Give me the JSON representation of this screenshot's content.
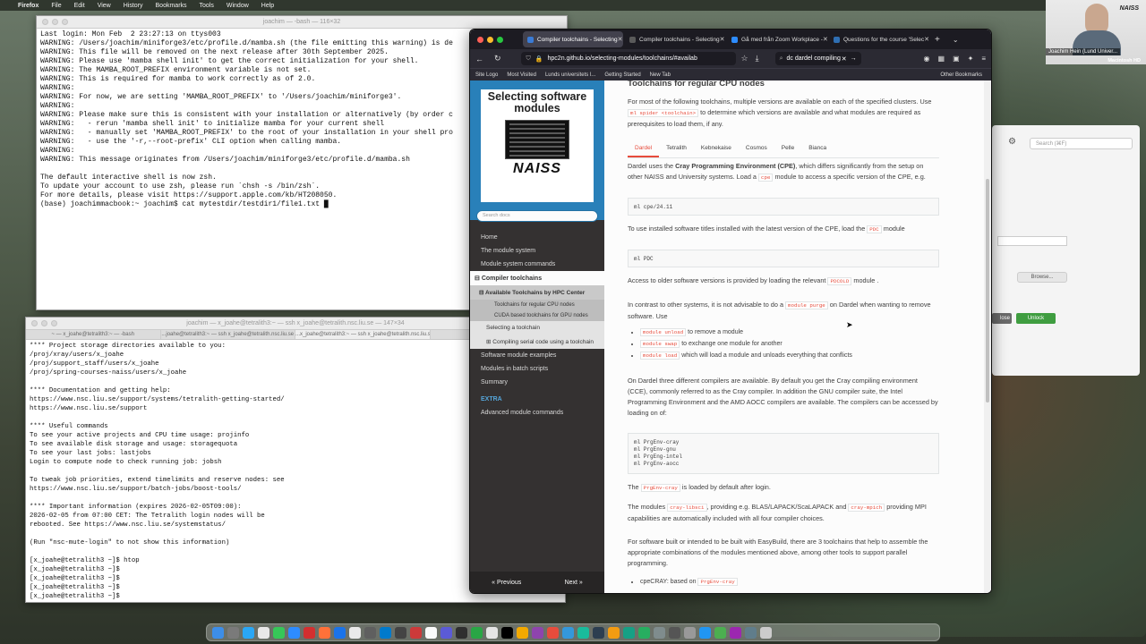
{
  "menubar": {
    "apple": "",
    "app": "Firefox",
    "items": [
      "File",
      "Edit",
      "View",
      "History",
      "Bookmarks",
      "Tools",
      "Window",
      "Help"
    ],
    "clock": "Mon 2 Feb 23:27"
  },
  "term1": {
    "title": "joachim — -bash — 116×32",
    "lines": "Last login: Mon Feb  2 23:27:13 on ttys003\nWARNING: /Users/joachim/miniforge3/etc/profile.d/mamba.sh (the file emitting this warning) is de\nWARNING: This file will be removed on the next release after 30th September 2025.\nWARNING: Please use 'mamba shell init' to get the correct initialization for your shell.\nWARNING: The MAMBA_ROOT_PREFIX environment variable is not set.\nWARNING: This is required for mamba to work correctly as of 2.0.\nWARNING:\nWARNING: For now, we are setting 'MAMBA_ROOT_PREFIX' to '/Users/joachim/miniforge3'.\nWARNING:\nWARNING: Please make sure this is consistent with your installation or alternatively (by order c\nWARNING:   - rerun 'mamba shell init' to initialize mamba for your current shell\nWARNING:   - manually set 'MAMBA_ROOT_PREFIX' to the root of your installation in your shell pro\nWARNING:   - use the '-r,--root-prefix' CLI option when calling mamba.\nWARNING:\nWARNING: This message originates from /Users/joachim/miniforge3/etc/profile.d/mamba.sh\n\nThe default interactive shell is now zsh.\nTo update your account to use zsh, please run `chsh -s /bin/zsh`.\nFor more details, please visit https://support.apple.com/kb/HT208050.\n(base) joachimmacbook:~ joachim$ cat mytestdir/testdir1/file1.txt █"
  },
  "term2": {
    "title": "joachim — x_joahe@tetralith3:~ — ssh x_joahe@tetralith.nsc.liu.se — 147×34",
    "tabs": [
      "~ — x_joahe@tetralith3:~ — -bash",
      "...joahe@tetralith3:~ — ssh x_joahe@tetralith.nsc.liu.se",
      "...x_joahe@tetralith3:~ — ssh x_joahe@tetralith.nsc.liu.se",
      ""
    ],
    "lines": "**** Project storage directories available to you:\n/proj/xray/users/x_joahe\n/proj/support_staff/users/x_joahe\n/proj/spring-courses-naiss/users/x_joahe\n\n**** Documentation and getting help:\nhttps://www.nsc.liu.se/support/systems/tetralith-getting-started/\nhttps://www.nsc.liu.se/support\n\n**** Useful commands\nTo see your active projects and CPU time usage: projinfo\nTo see available disk storage and usage: storagequota\nTo see your last jobs: lastjobs\nLogin to compute node to check running job: jobsh\n\nTo tweak job priorities, extend timelimits and reserve nodes: see\nhttps://www.nsc.liu.se/support/batch-jobs/boost-tools/\n\n**** Important information (expires 2026-02-05T09:00):\n2026-02-05 from 07:00 CET: The Tetralith login nodes will be\nrebooted. See https://www.nsc.liu.se/systemstatus/\n\n(Run \"nsc-mute-login\" to not show this information)\n\n[x_joahe@tetralith3 ~]$ htop\n[x_joahe@tetralith3 ~]$\n[x_joahe@tetralith3 ~]$\n[x_joahe@tetralith3 ~]$\n[x_joahe@tetralith3 ~]$\n[x_joahe@tetralith3 ~]$\n[x_joahe@tetralith3 ~]$\n[x_joahe@tetralith3 ~]$ htop\n[x_joahe@tetralith3 ~]$ █"
  },
  "browser": {
    "tabs": [
      {
        "label": "Compiler toolchains - Selecting",
        "active": true
      },
      {
        "label": "Compiler toolchains - Selecting",
        "active": false
      },
      {
        "label": "Gå med från Zoom Workplace -",
        "active": false
      },
      {
        "label": "Questions for the course 'Selec",
        "active": false
      }
    ],
    "url": "hpc2n.github.io/selecting-modules/toolchains/#availab",
    "find": "dc dardel compiling",
    "bookmarks": [
      "Site Logo",
      "Most Visited",
      "Lunds universitets l...",
      "Getting Started",
      "New Tab"
    ],
    "other_bookmarks": "Other Bookmarks"
  },
  "docs": {
    "logo_title": "Selecting software modules",
    "logo_brand": "NAISS",
    "search_placeholder": "Search docs",
    "nav_top": [
      "Home",
      "The module system",
      "Module system commands"
    ],
    "nav_current": "Compiler toolchains",
    "nav_sub": "Available Toolchains by HPC Center",
    "nav_sub3": [
      "Toolchains for regular CPU nodes",
      "CUDA based toolchains for GPU nodes"
    ],
    "nav_sub2": [
      "Selecting a toolchain",
      "Compiling serial code using a toolchain"
    ],
    "nav_bottom": [
      "Software module examples",
      "Modules in batch scripts",
      "Summary"
    ],
    "caption": "EXTRA",
    "nav_extra": [
      "Advanced module commands"
    ],
    "prev": "« Previous",
    "next": "Next »"
  },
  "content": {
    "heading": "Toolchains for regular CPU nodes",
    "intro_a": "For most of the following toolchains, multiple versions are available on each of the specified clusters. Use ",
    "intro_code": "ml spider <toolchain>",
    "intro_b": " to determine which versions are available and what modules are required as prerequisites to load them, if any.",
    "tabs": [
      "Dardel",
      "Tetralith",
      "Kebnekaise",
      "Cosmos",
      "Pelle",
      "Bianca"
    ],
    "p1_a": "Dardel uses the ",
    "p1_b": "Cray Programming Environment (CPE)",
    "p1_c": ", which differs significantly from the setup on other NAISS and University systems. Load a ",
    "p1_code": "cpe",
    "p1_d": " module to access a specific version of the CPE, e.g.",
    "code1": "ml cpe/24.11",
    "p2_a": "To use installed software titles installed with the latest version of the CPE, load the ",
    "p2_code": "PDC",
    "p2_b": " module",
    "code2": "ml PDC",
    "p3_a": "Access to older software versions is provided by loading the relevant ",
    "p3_code": "PDCOLD",
    "p3_b": " module .",
    "p4_a": "In contrast to other systems, it is not advisable to do a ",
    "p4_code": "module purge",
    "p4_b": " on Dardel when wanting to remove software. Use",
    "bullets": [
      {
        "code": "module unload",
        "text": " to remove a module"
      },
      {
        "code": "module swap",
        "text": " to exchange one module for another"
      },
      {
        "code": "module load",
        "text": " which will load a module and unloads everything that conflicts"
      }
    ],
    "p5": "On Dardel three different compilers are available. By default you get the Cray compiling environment (CCE), commonly referred to as the Cray compiler. In addition the GNU compiler suite, the Intel Programming Environment and the AMD AOCC compilers are available. The compilers can be accessed by loading on of:",
    "code3": "ml PrgEnv-cray\nml PrgEnv-gnu\nml PrgEng-intel\nml PrgEnv-aocc",
    "p6_a": "The ",
    "p6_code": "PrgEnv-cray",
    "p6_b": " is loaded by default after login.",
    "p7_a": "The modules ",
    "p7_code1": "cray-libsci",
    "p7_b": ", providing e.g. BLAS/LAPACK/ScaLAPACK and ",
    "p7_code2": "cray-mpich",
    "p7_c": " providing MPI capabilities are automatically included with all four compiler choices.",
    "p8": "For software built or intended to be built with EasyBuild, there are 3 toolchains that help to assemble the appropriate combinations of the modules mentioned above, among other tools to support parallel programming.",
    "b2_a": "cpeCRAY: based on ",
    "b2_code": "PrgEnv-cray"
  },
  "rightwin": {
    "search": "Search (⌘F)",
    "browse": "Browse...",
    "close": "lose",
    "unlock": "Unlock"
  },
  "webcam": {
    "name": "Joachim Hein (Lund Univer...",
    "brand": "NAISS",
    "mac": "Macintosh HD"
  }
}
